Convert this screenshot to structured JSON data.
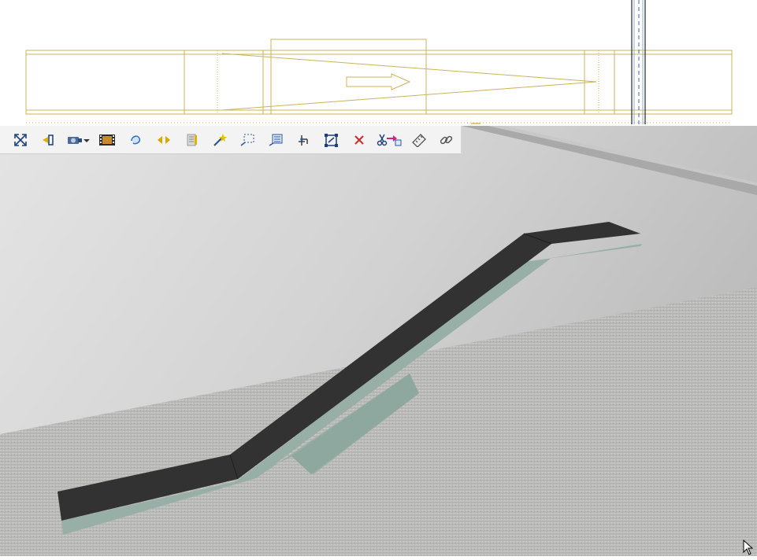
{
  "colors": {
    "plan_line": "#c9b45a",
    "plan_divider": "#7f9aa0",
    "wall": "#c9c9c9",
    "floor": "#b8b8b6",
    "tread": "#323232",
    "side": "#97afa6",
    "toolbar_bg": "#f3f3f3"
  },
  "toolbar": {
    "buttons": [
      {
        "id": "zoom-extents",
        "icon": "zoom-extents-icon"
      },
      {
        "id": "walk-in",
        "icon": "enter-view-icon"
      },
      {
        "id": "camera",
        "icon": "camera-dropdown-icon"
      },
      {
        "id": "render",
        "icon": "film-icon"
      },
      {
        "id": "orbit",
        "icon": "orbit-icon"
      },
      {
        "id": "pan",
        "icon": "pan-arrows-icon"
      },
      {
        "id": "layers",
        "icon": "layers-icon"
      },
      {
        "id": "magic-select",
        "icon": "magic-wand-icon"
      },
      {
        "id": "select-area",
        "icon": "marquee-select-icon"
      },
      {
        "id": "list-select",
        "icon": "list-select-icon"
      },
      {
        "id": "insert-point",
        "icon": "insert-point-icon"
      },
      {
        "id": "resize",
        "icon": "resize-icon"
      },
      {
        "id": "delete",
        "icon": "delete-icon"
      },
      {
        "id": "cut-paste",
        "icon": "cut-paste-icon"
      },
      {
        "id": "measure",
        "icon": "ruler-icon"
      },
      {
        "id": "link",
        "icon": "link-icon"
      }
    ]
  }
}
